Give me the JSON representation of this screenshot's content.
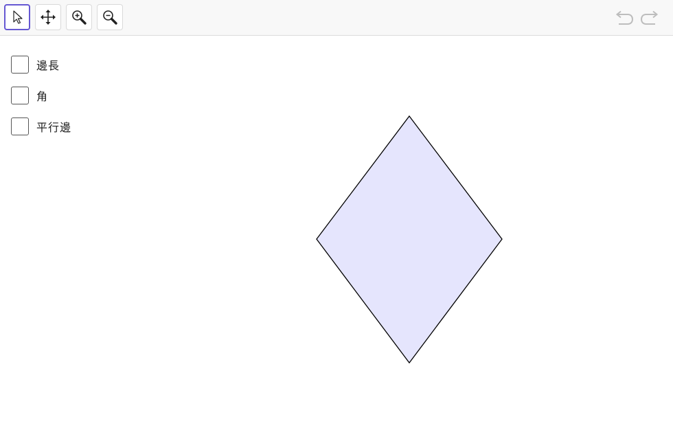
{
  "toolbar": {
    "tools": [
      {
        "name": "move-tool",
        "icon": "arrow-pointer-icon",
        "selected": true
      },
      {
        "name": "move-graphics-view-tool",
        "icon": "four-way-arrow-icon",
        "selected": false
      },
      {
        "name": "zoom-in-tool",
        "icon": "zoom-in-icon",
        "selected": false
      },
      {
        "name": "zoom-out-tool",
        "icon": "zoom-out-icon",
        "selected": false
      }
    ],
    "undo_icon": "undo-icon",
    "redo_icon": "redo-icon",
    "accent_color": "#6557d2"
  },
  "checkboxes": [
    {
      "label": "邊長",
      "checked": false
    },
    {
      "label": "角",
      "checked": false
    },
    {
      "label": "平行邊",
      "checked": false
    }
  ],
  "shape": {
    "type": "rhombus",
    "fill_color": "#e5e5fd",
    "stroke_color": "#000000"
  }
}
